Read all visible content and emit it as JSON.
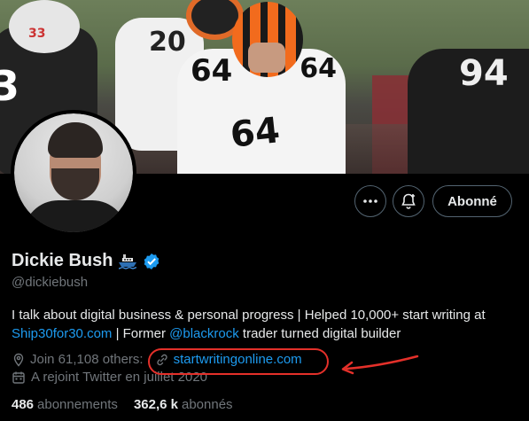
{
  "banner": {
    "numbers": [
      "33",
      "20",
      "64",
      "64",
      "64",
      "94",
      "3"
    ]
  },
  "actions": {
    "follow_label": "Abonné"
  },
  "profile": {
    "name": "Dickie Bush",
    "handle": "@dickiebush",
    "bio_text_1": "I talk about digital business & personal progress | Helped 10,000+ start writing at ",
    "bio_link_1": "Ship30for30.com",
    "bio_text_2": " | Former ",
    "bio_mention": "@blackrock",
    "bio_text_3": " trader turned digital builder",
    "location": "Join 61,108 others:",
    "website": "startwritingonline.com",
    "joined": "A rejoint Twitter en juillet 2020",
    "following_count": "486",
    "following_label": "abonnements",
    "followers_count": "362,6 k",
    "followers_label": "abonnés"
  },
  "colors": {
    "accent": "#1d9bf0",
    "highlight": "#e4302a",
    "muted": "#71767b"
  },
  "icons": [
    "ship-icon",
    "verified-icon",
    "more-icon",
    "notification-bell-icon",
    "location-icon",
    "link-icon",
    "calendar-icon",
    "arrow-icon"
  ]
}
